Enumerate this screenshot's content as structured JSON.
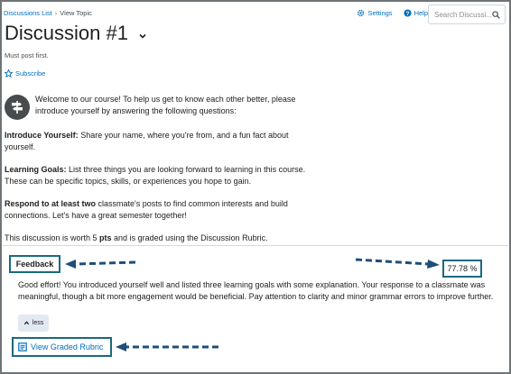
{
  "breadcrumb": {
    "parent": "Discussions List",
    "separator": "›",
    "current": "View Topic"
  },
  "toolbar": {
    "settings_label": "Settings",
    "help_label": "Help"
  },
  "search": {
    "placeholder": "Search Discussi..."
  },
  "page": {
    "title": "Discussion #1",
    "note": "Must post first.",
    "subscribe_label": "Subscribe"
  },
  "content": {
    "intro": "Welcome to our course! To help us get to know each other better, please introduce yourself by answering the following questions:",
    "item1_label": "Introduce Yourself:",
    "item1_text": " Share your name, where you're from, and a fun fact about yourself.",
    "item2_label": "Learning Goals:",
    "item2_text": " List three things you are looking forward to learning in this course. These can be specific topics, skills, or experiences you hope to gain.",
    "item3_label": "Respond to at least two",
    "item3_text": " classmate's posts to find common interests and build connections. Let's have a great semester together!",
    "worth_prefix": "This discussion is worth 5 ",
    "worth_bold": "pts",
    "worth_suffix": " and is graded using the Discussion Rubric."
  },
  "feedback": {
    "label": "Feedback",
    "score": "77.78 %",
    "text": "Good effort! You introduced yourself well and listed three learning goals with some explanation. Your response to a classmate was meaningful, though a bit more engagement would be beneficial. Pay attention to clarity and minor grammar errors to improve further.",
    "less_label": "less",
    "rubric_link": "View Graded Rubric"
  },
  "colors": {
    "link": "#006fbf",
    "highlight_border": "#1a6a7d",
    "annotation_arrow": "#1f4e79"
  },
  "icons": [
    "settings-gear-icon",
    "help-circle-icon",
    "search-icon",
    "chevron-down-icon",
    "star-icon",
    "signpost-icon",
    "chevron-up-icon",
    "rubric-icon"
  ]
}
